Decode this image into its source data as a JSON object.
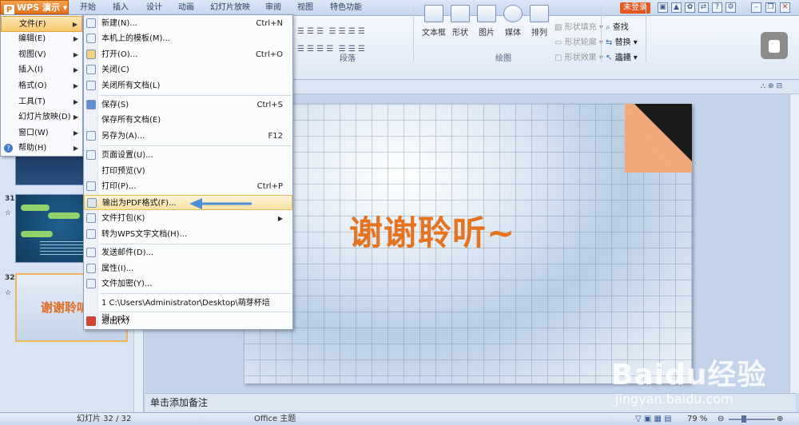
{
  "app": {
    "name": "WPS 演示"
  },
  "ribbon": {
    "tabs": [
      "开始",
      "插入",
      "设计",
      "动画",
      "幻灯片放映",
      "审阅",
      "视图",
      "特色功能"
    ],
    "login": "未登录",
    "groups": {
      "paragraph": "段落",
      "drawing": "绘图",
      "editing": "编辑"
    },
    "buttons": {
      "textbox": "文本框",
      "shape": "形状",
      "picture": "图片",
      "media": "媒体",
      "arrange": "排列",
      "shape_fill": "形状填充",
      "shape_outline": "形状轮廓",
      "shape_effect": "形状效果",
      "find": "查找",
      "replace": "替换",
      "select": "选择"
    }
  },
  "main_menu": {
    "items": [
      {
        "label": "文件(F)",
        "has_sub": true
      },
      {
        "label": "编辑(E)",
        "has_sub": true
      },
      {
        "label": "视图(V)",
        "has_sub": true
      },
      {
        "label": "插入(I)",
        "has_sub": true
      },
      {
        "label": "格式(O)",
        "has_sub": true
      },
      {
        "label": "工具(T)",
        "has_sub": true
      },
      {
        "label": "幻灯片放映(D)",
        "has_sub": true
      },
      {
        "label": "窗口(W)",
        "has_sub": true
      },
      {
        "label": "帮助(H)",
        "has_sub": true
      }
    ]
  },
  "file_menu": {
    "items": [
      {
        "label": "新建(N)...",
        "shortcut": "Ctrl+N"
      },
      {
        "label": "本机上的模板(M)...",
        "shortcut": ""
      },
      {
        "label": "打开(O)...",
        "shortcut": "Ctrl+O"
      },
      {
        "label": "关闭(C)",
        "shortcut": ""
      },
      {
        "label": "关闭所有文档(L)",
        "shortcut": ""
      },
      {
        "label": "保存(S)",
        "shortcut": "Ctrl+S"
      },
      {
        "label": "保存所有文档(E)",
        "shortcut": ""
      },
      {
        "label": "另存为(A)...",
        "shortcut": "F12"
      },
      {
        "label": "页面设置(U)...",
        "shortcut": ""
      },
      {
        "label": "打印预览(V)",
        "shortcut": ""
      },
      {
        "label": "打印(P)...",
        "shortcut": "Ctrl+P"
      },
      {
        "label": "输出为PDF格式(F)...",
        "shortcut": ""
      },
      {
        "label": "文件打包(K)",
        "shortcut": ""
      },
      {
        "label": "转为WPS文字文档(H)...",
        "shortcut": ""
      },
      {
        "label": "发送邮件(D)...",
        "shortcut": ""
      },
      {
        "label": "属性(I)...",
        "shortcut": ""
      },
      {
        "label": "文件加密(Y)...",
        "shortcut": ""
      },
      {
        "label": "1 C:\\Users\\Administrator\\Desktop\\萌芽杯培训.pptx",
        "shortcut": ""
      },
      {
        "label": "退出(X)",
        "shortcut": ""
      }
    ]
  },
  "slides_panel": {
    "numbers": [
      "31",
      "32"
    ],
    "thumb32_title": "谢谢聆听"
  },
  "slide": {
    "title": "谢谢聆听~"
  },
  "notes": {
    "placeholder": "单击添加备注"
  },
  "status": {
    "slide_count": "幻灯片 32 / 32",
    "theme": "Office 主题",
    "zoom": "79 %"
  },
  "watermark": {
    "logo": "Baidu经验",
    "url": "jingyan.baidu.com"
  },
  "colors": {
    "accent": "#e8731f",
    "highlight": "#f7c96d",
    "arrow": "#4a90d9"
  }
}
